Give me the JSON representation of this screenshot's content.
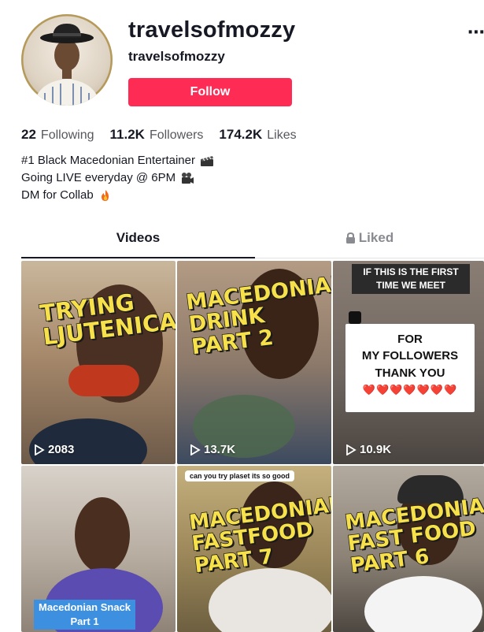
{
  "profile": {
    "username": "travelsofmozzy",
    "nickname": "travelsofmozzy",
    "more_label": "⋯",
    "follow_label": "Follow"
  },
  "stats": [
    {
      "value": "22",
      "label": "Following"
    },
    {
      "value": "11.2K",
      "label": "Followers"
    },
    {
      "value": "174.2K",
      "label": "Likes"
    }
  ],
  "bio": [
    {
      "text": "#1 Black Macedonian Entertainer",
      "icon": "clapper-board-icon"
    },
    {
      "text": "Going LIVE everyday @ 6PM",
      "icon": "video-camera-icon"
    },
    {
      "text": "DM for Collab",
      "icon": "fire-icon"
    }
  ],
  "tabs": {
    "videos": "Videos",
    "liked": "Liked"
  },
  "videos": [
    {
      "caption": [
        "TRYING",
        "LJUTENICA"
      ],
      "views": "2083"
    },
    {
      "caption": [
        "MACEDONIAN",
        "DRINK",
        "PART 2"
      ],
      "views": "13.7K"
    },
    {
      "caption_top": [
        "IF THIS IS THE FIRST",
        "TIME WE MEET"
      ],
      "card": [
        "FOR",
        "MY FOLLOWERS",
        "THANK YOU"
      ],
      "hearts": "❤️❤️❤️❤️❤️❤️❤️",
      "views": "10.9K"
    },
    {
      "label": [
        "Macedonian Snack",
        "Part 1"
      ]
    },
    {
      "reply": "can you try plaset its so good",
      "caption": [
        "MACEDONIAN",
        "FASTFOOD",
        "PART 7"
      ]
    },
    {
      "caption": [
        "MACEDONIAN",
        "FAST FOOD",
        "PART 6"
      ]
    }
  ],
  "colors": {
    "follow": "#fe2c55",
    "caption_yellow": "#f7e14a",
    "label_blue": "#3d8fe0"
  }
}
